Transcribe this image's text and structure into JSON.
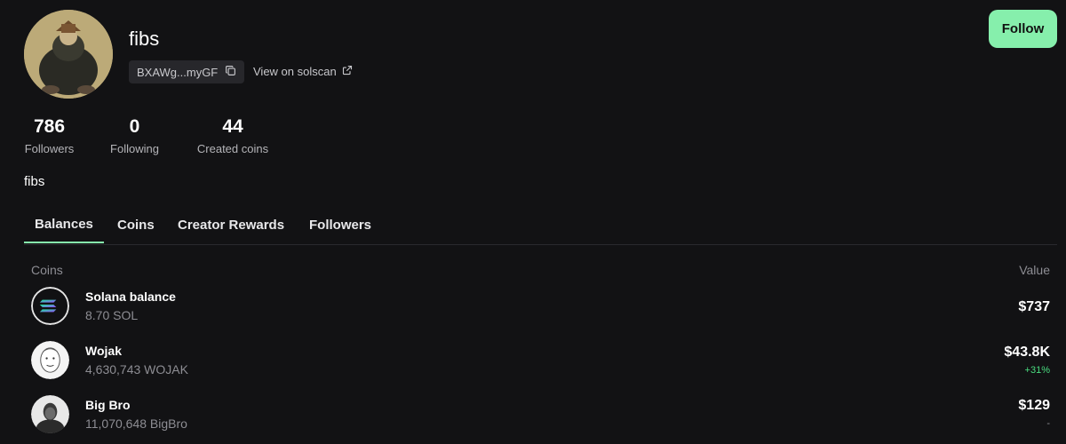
{
  "profile": {
    "username": "fibs",
    "address_short": "BXAWg...myGF",
    "solscan_label": "View on solscan",
    "bio": "fibs"
  },
  "actions": {
    "follow_label": "Follow"
  },
  "stats": [
    {
      "value": "786",
      "label": "Followers"
    },
    {
      "value": "0",
      "label": "Following"
    },
    {
      "value": "44",
      "label": "Created coins"
    }
  ],
  "tabs": [
    {
      "label": "Balances",
      "active": true
    },
    {
      "label": "Coins",
      "active": false
    },
    {
      "label": "Creator Rewards",
      "active": false
    },
    {
      "label": "Followers",
      "active": false
    }
  ],
  "table": {
    "headers": {
      "coins": "Coins",
      "value": "Value"
    },
    "rows": [
      {
        "name": "Solana balance",
        "amount": "8.70 SOL",
        "value": "$737",
        "change": "",
        "icon": "solana-logo-icon"
      },
      {
        "name": "Wojak",
        "amount": "4,630,743 WOJAK",
        "value": "$43.8K",
        "change": "+31%",
        "icon": "wojak-coin-icon"
      },
      {
        "name": "Big Bro",
        "amount": "11,070,648 BigBro",
        "value": "$129",
        "change": "-",
        "icon": "bigbro-coin-icon"
      }
    ]
  },
  "colors": {
    "background": "#121214",
    "accent": "#86efac",
    "positive": "#4ade80",
    "muted": "#8d8d93"
  }
}
